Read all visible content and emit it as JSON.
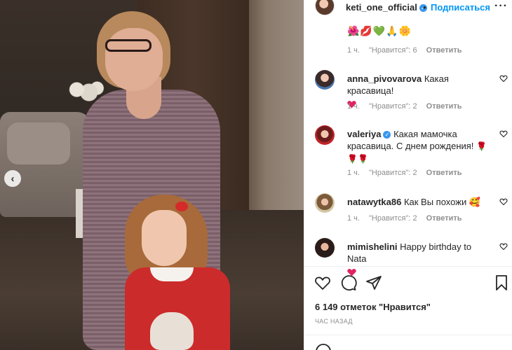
{
  "post": {
    "carousel_prev": "‹"
  },
  "header": {
    "username": "keti_one_official",
    "verified_mark": "✓",
    "separator": "•",
    "follow_label": "Подписаться",
    "more_label": "···"
  },
  "caption_tail": {
    "emojis": "🌺💋💚🙏🌼",
    "time": "1 ч.",
    "likes": "\"Нравится\": 6",
    "reply": "Ответить"
  },
  "comments": [
    {
      "username": "anna_pivovarova",
      "verified": false,
      "text": "Какая красавица!",
      "time": "1 ч.",
      "likes": "\"Нравится\": 2",
      "reply": "Ответить"
    },
    {
      "username": "valeriya",
      "verified": true,
      "verified_mark": "✓",
      "text": "Какая мамочка красавица. С днем рождения!",
      "time": "1 ч.",
      "likes": "\"Нравится\": 2",
      "reply": "Ответить"
    },
    {
      "username": "natawytka86",
      "verified": false,
      "text": "Как Вы похожи",
      "time": "1 ч.",
      "likes": "\"Нравится\": 2",
      "reply": "Ответить"
    },
    {
      "username": "mimishelini",
      "verified": false,
      "text": "Happy birthday to Nata"
    }
  ],
  "post_footer": {
    "likes_count": "6 149 отметок \"Нравится\"",
    "time_ago": "ЧАС НАЗАД"
  },
  "colors": {
    "accent": "#0095f6",
    "verified": "#3897f0",
    "heart": "#ed4956",
    "text": "#262626",
    "muted": "#8e8e8e"
  },
  "icons": [
    "heart-icon",
    "comment-icon",
    "share-icon",
    "bookmark-icon",
    "rose-emoji",
    "smiling-heart-eyes-emoji",
    "chevron-left-icon",
    "more-icon",
    "verified-icon"
  ]
}
